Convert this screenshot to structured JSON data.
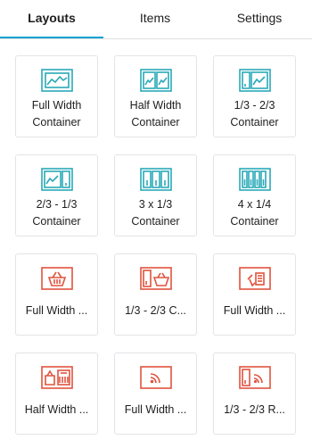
{
  "tabs": [
    {
      "label": "Layouts",
      "active": true
    },
    {
      "label": "Items",
      "active": false
    },
    {
      "label": "Settings",
      "active": false
    }
  ],
  "colors": {
    "accent": "#00a0d2",
    "layout_icon": "#2aa9b8",
    "item_icon": "#e0533d",
    "card_border": "#e2e4e7"
  },
  "cards": [
    {
      "label": "Full Width Container",
      "icon": "full-width-container-icon"
    },
    {
      "label": "Half Width Container",
      "icon": "half-width-container-icon"
    },
    {
      "label": "1/3 - 2/3 Container",
      "icon": "one-third-two-thirds-container-icon"
    },
    {
      "label": "2/3 - 1/3 Container",
      "icon": "two-thirds-one-third-container-icon"
    },
    {
      "label": "3 x 1/3 Container",
      "icon": "three-thirds-container-icon"
    },
    {
      "label": "4 x 1/4 Container",
      "icon": "four-quarters-container-icon"
    },
    {
      "label": "Full Width ...",
      "icon": "basket-item-icon"
    },
    {
      "label": "1/3 - 2/3 C...",
      "icon": "basket-split-item-icon"
    },
    {
      "label": "Full Width ...",
      "icon": "cart-list-item-icon"
    },
    {
      "label": "Half Width ...",
      "icon": "bag-barcode-item-icon"
    },
    {
      "label": "Full Width ...",
      "icon": "rss-item-icon"
    },
    {
      "label": "1/3 - 2/3 R...",
      "icon": "rss-split-item-icon"
    }
  ]
}
